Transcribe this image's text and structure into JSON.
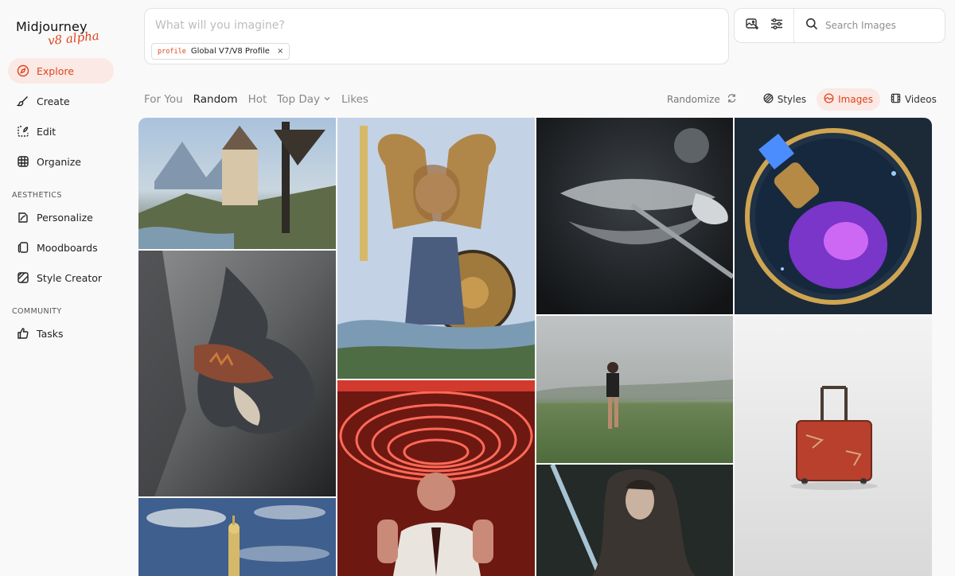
{
  "app": {
    "logo_text": "Midjourney",
    "logo_sub": "v8 alpha",
    "accent_color": "#e0431b"
  },
  "sidebar": {
    "items": [
      {
        "label": "Explore",
        "icon": "compass-icon",
        "active": true
      },
      {
        "label": "Create",
        "icon": "brush-icon"
      },
      {
        "label": "Edit",
        "icon": "edit-icon"
      },
      {
        "label": "Organize",
        "icon": "grid-icon"
      }
    ],
    "aesthetics_heading": "AESTHETICS",
    "aesthetics_items": [
      {
        "label": "Personalize",
        "icon": "personalize-icon"
      },
      {
        "label": "Moodboards",
        "icon": "moodboard-icon"
      },
      {
        "label": "Style Creator",
        "icon": "style-creator-icon"
      }
    ],
    "community_heading": "COMMUNITY",
    "community_items": [
      {
        "label": "Tasks",
        "icon": "thumbs-up-icon"
      }
    ]
  },
  "prompt": {
    "placeholder": "What will you imagine?",
    "value": "",
    "chip_key": "profile",
    "chip_value": "Global V7/V8 Profile",
    "chip_close": "×"
  },
  "toolbar": {
    "icons": [
      "image-add-icon",
      "sliders-icon"
    ],
    "search_placeholder": "Search Images"
  },
  "feed_tabs": [
    {
      "label": "For You"
    },
    {
      "label": "Random",
      "active": true
    },
    {
      "label": "Hot"
    },
    {
      "label": "Top Day",
      "dropdown": true
    },
    {
      "label": "Likes"
    }
  ],
  "controls": {
    "randomize_label": "Randomize",
    "styles_label": "Styles",
    "images_label": "Images",
    "videos_label": "Videos",
    "active_filter": "Images"
  },
  "gallery": {
    "tiles": [
      {
        "name": "castle-landscape-image",
        "colors": [
          "#9bb5cf",
          "#6b7f5a",
          "#3b3a33"
        ]
      },
      {
        "name": "dragon-painting-image",
        "colors": [
          "#6d6f70",
          "#8a4a34",
          "#2c2e30"
        ]
      },
      {
        "name": "tower-sky-image",
        "colors": [
          "#3c5a8a",
          "#d8c07a",
          "#27375a"
        ]
      },
      {
        "name": "angel-warrior-image",
        "colors": [
          "#c6d3e8",
          "#b48a45",
          "#3a4b6a"
        ]
      },
      {
        "name": "neon-rings-man-image",
        "colors": [
          "#d23a2e",
          "#ff8c7a",
          "#3a0f0d"
        ]
      },
      {
        "name": "dragonfly-image",
        "colors": [
          "#2b2f33",
          "#b9bdc0",
          "#111315"
        ]
      },
      {
        "name": "foggy-field-woman-image",
        "colors": [
          "#b8bcbd",
          "#5a7a45",
          "#2e2e2e"
        ]
      },
      {
        "name": "dark-woman-portrait-image",
        "colors": [
          "#2d3532",
          "#9cb7c7",
          "#151a18"
        ]
      },
      {
        "name": "potion-bottle-image",
        "colors": [
          "#1c2b3a",
          "#7a35c9",
          "#d6a84b"
        ]
      },
      {
        "name": "red-suitcase-image",
        "colors": [
          "#ececec",
          "#b8402c",
          "#d4d4d4"
        ]
      }
    ]
  }
}
